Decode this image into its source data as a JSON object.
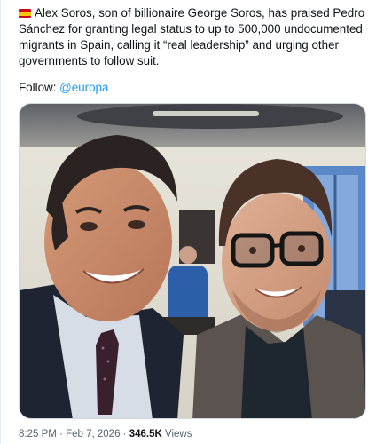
{
  "tweet": {
    "flag": "spain-flag-icon",
    "text": "Alex Soros, son of billionaire George Soros, has praised Pedro Sánchez for granting legal status to up to 500,000 undocumented migrants in Spain, calling it “real leadership” and urging other governments to follow suit.",
    "follow_label": "Follow:",
    "follow_handle": "@europa",
    "time": "8:25 PM",
    "separator": "·",
    "date": "Feb 7, 2026",
    "views_count": "346.5K",
    "views_label": "Views"
  },
  "colors": {
    "accent": "#1d9bf0",
    "text": "#0f1419",
    "secondary": "#536471"
  }
}
